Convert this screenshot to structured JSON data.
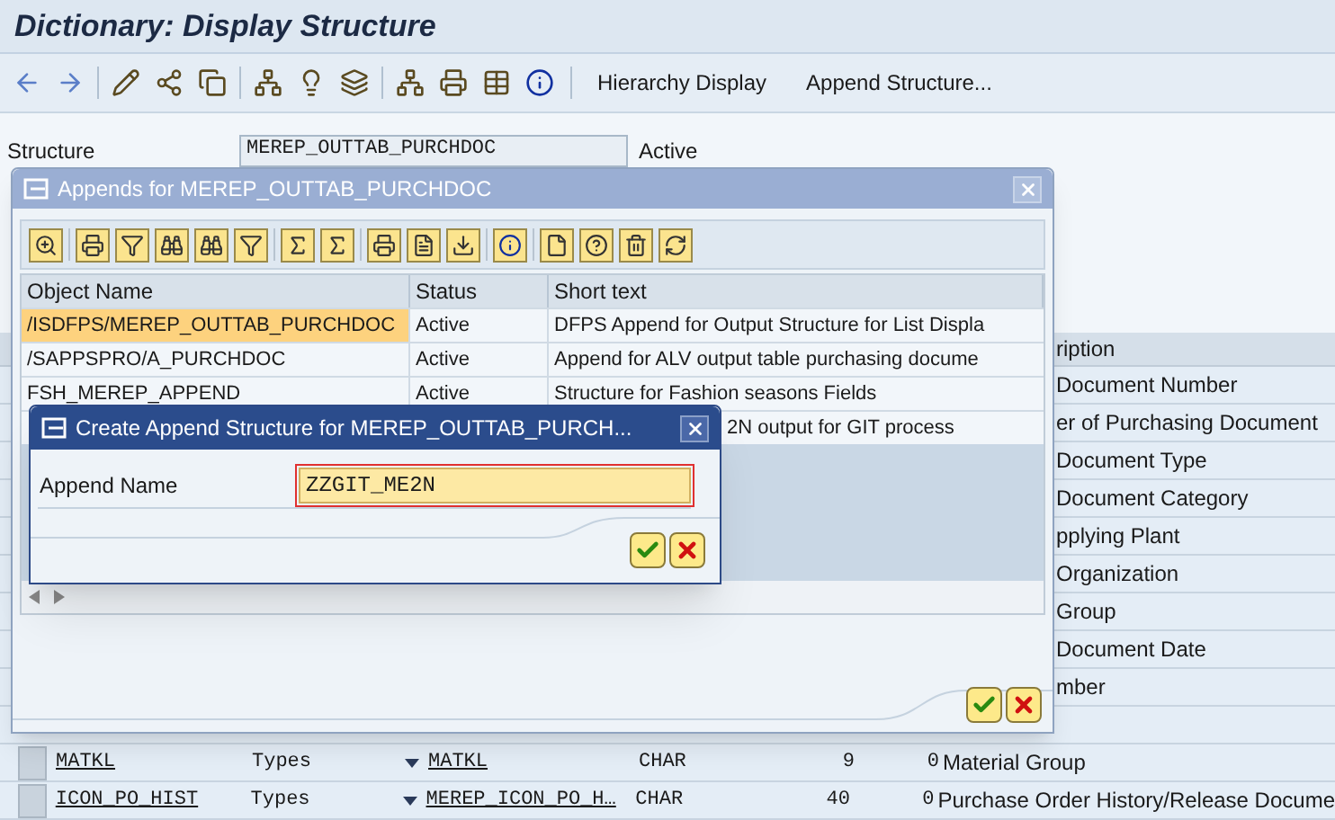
{
  "window": {
    "title": "Dictionary: Display Structure"
  },
  "toolbar": {
    "buttons": [
      "Hierarchy Display",
      "Append Structure..."
    ]
  },
  "header": {
    "structure_label": "Structure",
    "structure_value": "MEREP_OUTTAB_PURCHDOC",
    "status": "Active"
  },
  "fields_table": {
    "description_header": "ription",
    "rows": [
      {
        "kind": "covered",
        "description": "Document Number"
      },
      {
        "kind": "covered",
        "description": "er of Purchasing Document"
      },
      {
        "kind": "covered",
        "description": "Document Type"
      },
      {
        "kind": "covered",
        "description": "Document Category"
      },
      {
        "kind": "covered",
        "description": "pplying Plant"
      },
      {
        "kind": "covered",
        "description": "Organization"
      },
      {
        "kind": "covered",
        "description": "Group"
      },
      {
        "kind": "covered",
        "description": "Document Date"
      },
      {
        "kind": "covered",
        "description": "mber"
      },
      {
        "kind": "empty"
      },
      {
        "kind": "full",
        "field": "MATKL",
        "typing": "Types",
        "data_element": "MATKL",
        "type": "CHAR",
        "length": "9",
        "decimals": "0",
        "description": "Material Group"
      },
      {
        "kind": "full",
        "field": "ICON_PO_HIST",
        "typing": "Types",
        "data_element": "MEREP_ICON_PO_H…",
        "type": "CHAR",
        "length": "40",
        "decimals": "0",
        "description": "Purchase Order History/Release Docume"
      }
    ]
  },
  "appends_dialog": {
    "title": "Appends for MEREP_OUTTAB_PURCHDOC",
    "columns": [
      "Object Name",
      "Status",
      "Short text"
    ],
    "rows": [
      {
        "kind": "full",
        "object_name": "/ISDFPS/MEREP_OUTTAB_PURCHDOC",
        "status": "Active",
        "short_text": "DFPS Append for Output Structure for List Displa",
        "selected": true
      },
      {
        "kind": "full",
        "object_name": "/SAPPSPRO/A_PURCHDOC",
        "status": "Active",
        "short_text": "Append for ALV output table purchasing docume",
        "selected": false
      },
      {
        "kind": "full",
        "object_name": "FSH_MEREP_APPEND",
        "status": "Active",
        "short_text": "Structure for Fashion seasons Fields",
        "selected": false
      },
      {
        "kind": "covered",
        "short_text": "2N output for GIT process",
        "selected": false
      }
    ]
  },
  "create_dialog": {
    "title": "Create Append Structure for MEREP_OUTTAB_PURCH...",
    "field_label": "Append Name",
    "field_value": "ZZGIT_ME2N"
  }
}
